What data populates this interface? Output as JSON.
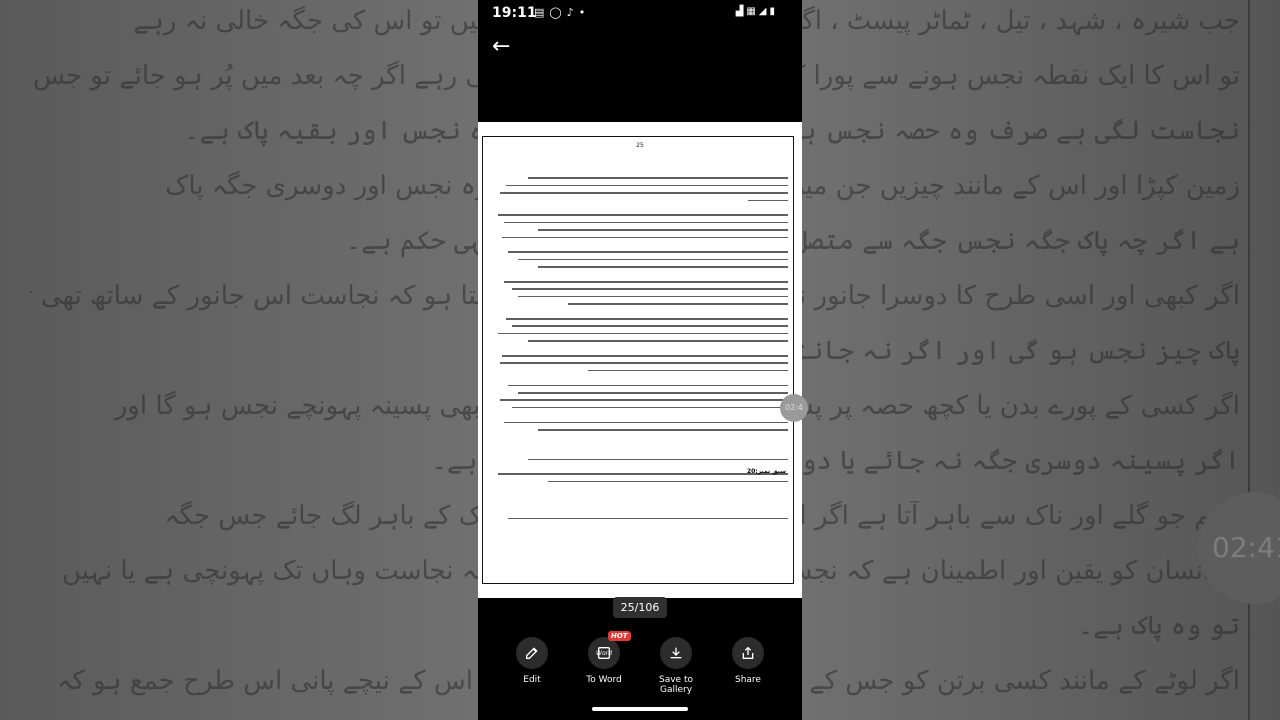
{
  "status_bar": {
    "time": "19:11"
  },
  "document": {
    "page_number": "25",
    "section_heading": "سبق نمبر:20",
    "page_indicator": "25/106"
  },
  "background": {
    "lines": [
      "جب شیرہ ، شہد ، تیل ، ٹماٹر پیسٹ ، اگر اس میں سے کچھ مقدار نکالیں تو اس کی جگہ خالی نہ رہے",
      "تو اس کا ایک نقطہ نجس ہونے سے پورا کا پورا نجس اس کی جگہ خالی رہے اگر چہ بعد میں پُر ہو جائے تو جس جگہ پر",
      "نجاست لگی ہے صرف وہ حصہ نجس ہو گا پس اس پر گری ہے وہ نجس اور بقیہ پاک ہے۔",
      "زمین کپڑا اور اس کے مانند چیزیں جن میں حصے سے نجاست لگ جائے وہ نجس اور دوسری جگہ پاک",
      "ہے اگر چہ پاک جگہ نجس جگہ سے متصل ہی کیوں چیزوں کا بھی یہی حکم ہے۔",
      "اگر کبھی اور اسی طرح کا دوسرا جانور نجس ہے چنانچہ اگر انسان جانتا ہو کہ نجاست اس جانور کے ساتھ تھی تو",
      "پاک چیز نجس ہو گی اور اگر نہ جانتا ہو تو پاک ہے۔",
      "اگر کسی کے پورے بدن یا کچھ حصہ پر پسینہ جگہ پہونچ جائے تو جہاں بھی پسینہ پہونچے نجس ہو گا اور",
      "اگر پسینہ دوسری جگہ نہ جائے یا دوسری جگہ کی دوسری جگہ پاک ہے۔",
      "بلغم جو گلے اور ناک سے باہر آتا ہے اگر اس پاک ہے پس اگر منہ اور ناک کے باہر لگ جائے جس جگہ",
      "پر انسان کو یقین اور اطمینان ہے کہ نجس بلغم کے بارے میں شک ہے کہ نجاست وہاں تک پہونچی ہے یا نہیں",
      "تو وہ پاک ہے۔",
      "اگر لوٹے کے مانند کسی برتن کو جس کے پیندے پانی بہتا بند ہو جائے اور اس کے نیچے پانی اس طرح جمع ہو کہ"
    ],
    "timer_text": "02:41"
  },
  "action_bar": {
    "edit_label": "Edit",
    "to_word_label": "To Word",
    "hot_badge": "HOT",
    "word_icon_text": "Word",
    "save_label": "Save to Gallery",
    "share_label": "Share"
  },
  "timer_overlay": "02:4"
}
